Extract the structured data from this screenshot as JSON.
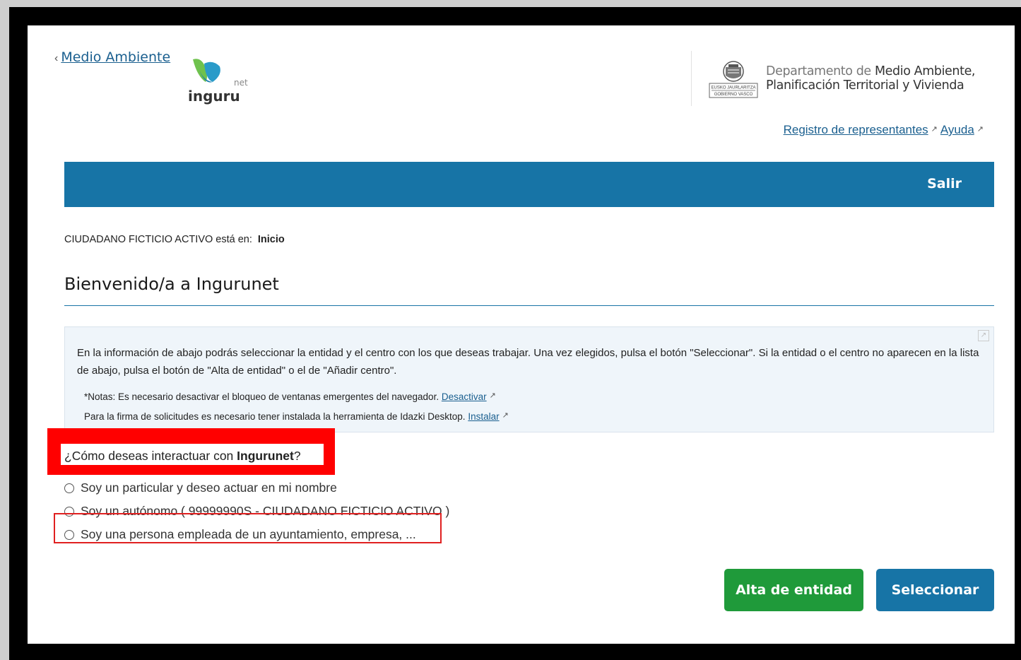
{
  "header": {
    "back_link": "Medio Ambiente",
    "logo_name": "inguru",
    "logo_suffix": "net",
    "dept_light": "Departamento de",
    "dept_strong": "Medio Ambiente,",
    "dept_line2": "Planificación Territorial y Vivienda",
    "gov_label_1": "EUSKO JAURLARITZA",
    "gov_label_2": "GOBIERNO VASCO",
    "links": [
      {
        "label": "Registro de representantes"
      },
      {
        "label": "Ayuda"
      }
    ]
  },
  "navbar": {
    "exit_label": "Salir"
  },
  "breadcrumb": {
    "prefix": "CIUDADANO FICTICIO ACTIVO está en:",
    "current": "Inicio"
  },
  "page_title": "Bienvenido/a a Ingurunet",
  "info": {
    "main_text": "En la información de abajo podrás seleccionar la entidad y el centro con los que deseas trabajar. Una vez elegidos, pulsa el botón \"Seleccionar\". Si la entidad o el centro no aparecen en la lista de abajo, pulsa el botón de \"Alta de entidad\" o el de \"Añadir centro\".",
    "note1_text": "*Notas: Es necesario desactivar el bloqueo de ventanas emergentes del navegador.",
    "note1_link": "Desactivar",
    "note2_text": "Para la firma de solicitudes es necesario tener instalada la herramienta de Idazki Desktop.",
    "note2_link": "Instalar"
  },
  "question": {
    "prefix": "¿Cómo deseas interactuar con ",
    "strong": "Ingurunet",
    "suffix": "?"
  },
  "options": [
    {
      "label": "Soy un particular y deseo actuar en mi nombre"
    },
    {
      "label": "Soy un autónomo ( 99999990S - CIUDADANO FICTICIO ACTIVO )"
    },
    {
      "label": "Soy una persona empleada de un ayuntamiento, empresa, ..."
    }
  ],
  "buttons": {
    "alta": "Alta de entidad",
    "select": "Seleccionar"
  },
  "colors": {
    "primary": "#1774a6",
    "success": "#1f9a3a",
    "highlight": "#ff0000"
  }
}
